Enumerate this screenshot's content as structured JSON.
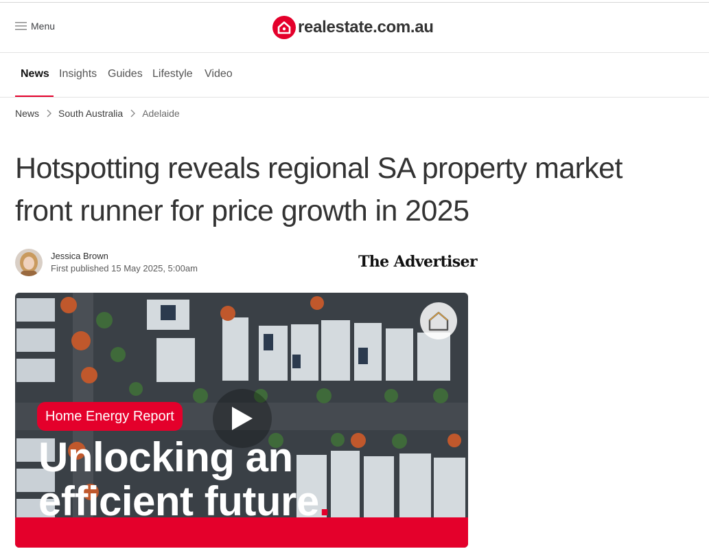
{
  "header": {
    "menu_label": "Menu",
    "logo_text": "realestate.com.au",
    "brand_color": "#e4002b"
  },
  "nav": {
    "tabs": [
      {
        "label": "News",
        "active": true
      },
      {
        "label": "Insights",
        "active": false
      },
      {
        "label": "Guides",
        "active": false
      },
      {
        "label": "Lifestyle",
        "active": false
      },
      {
        "label": "Video",
        "active": false
      }
    ]
  },
  "breadcrumb": {
    "items": [
      "News",
      "South Australia",
      "Adelaide"
    ]
  },
  "article": {
    "title_line1": "Hotspotting reveals regional SA property market",
    "title_line2": "front runner for price growth in 2025",
    "author": "Jessica Brown",
    "published": "First published 15 May 2025, 5:00am",
    "publisher": "The Advertiser"
  },
  "video": {
    "tag": "Home Energy Report",
    "headline_line1": "Unlocking an",
    "headline_line2": "efficient future",
    "headline_dot": ".",
    "icons": [
      "play-icon",
      "home-icon"
    ]
  }
}
